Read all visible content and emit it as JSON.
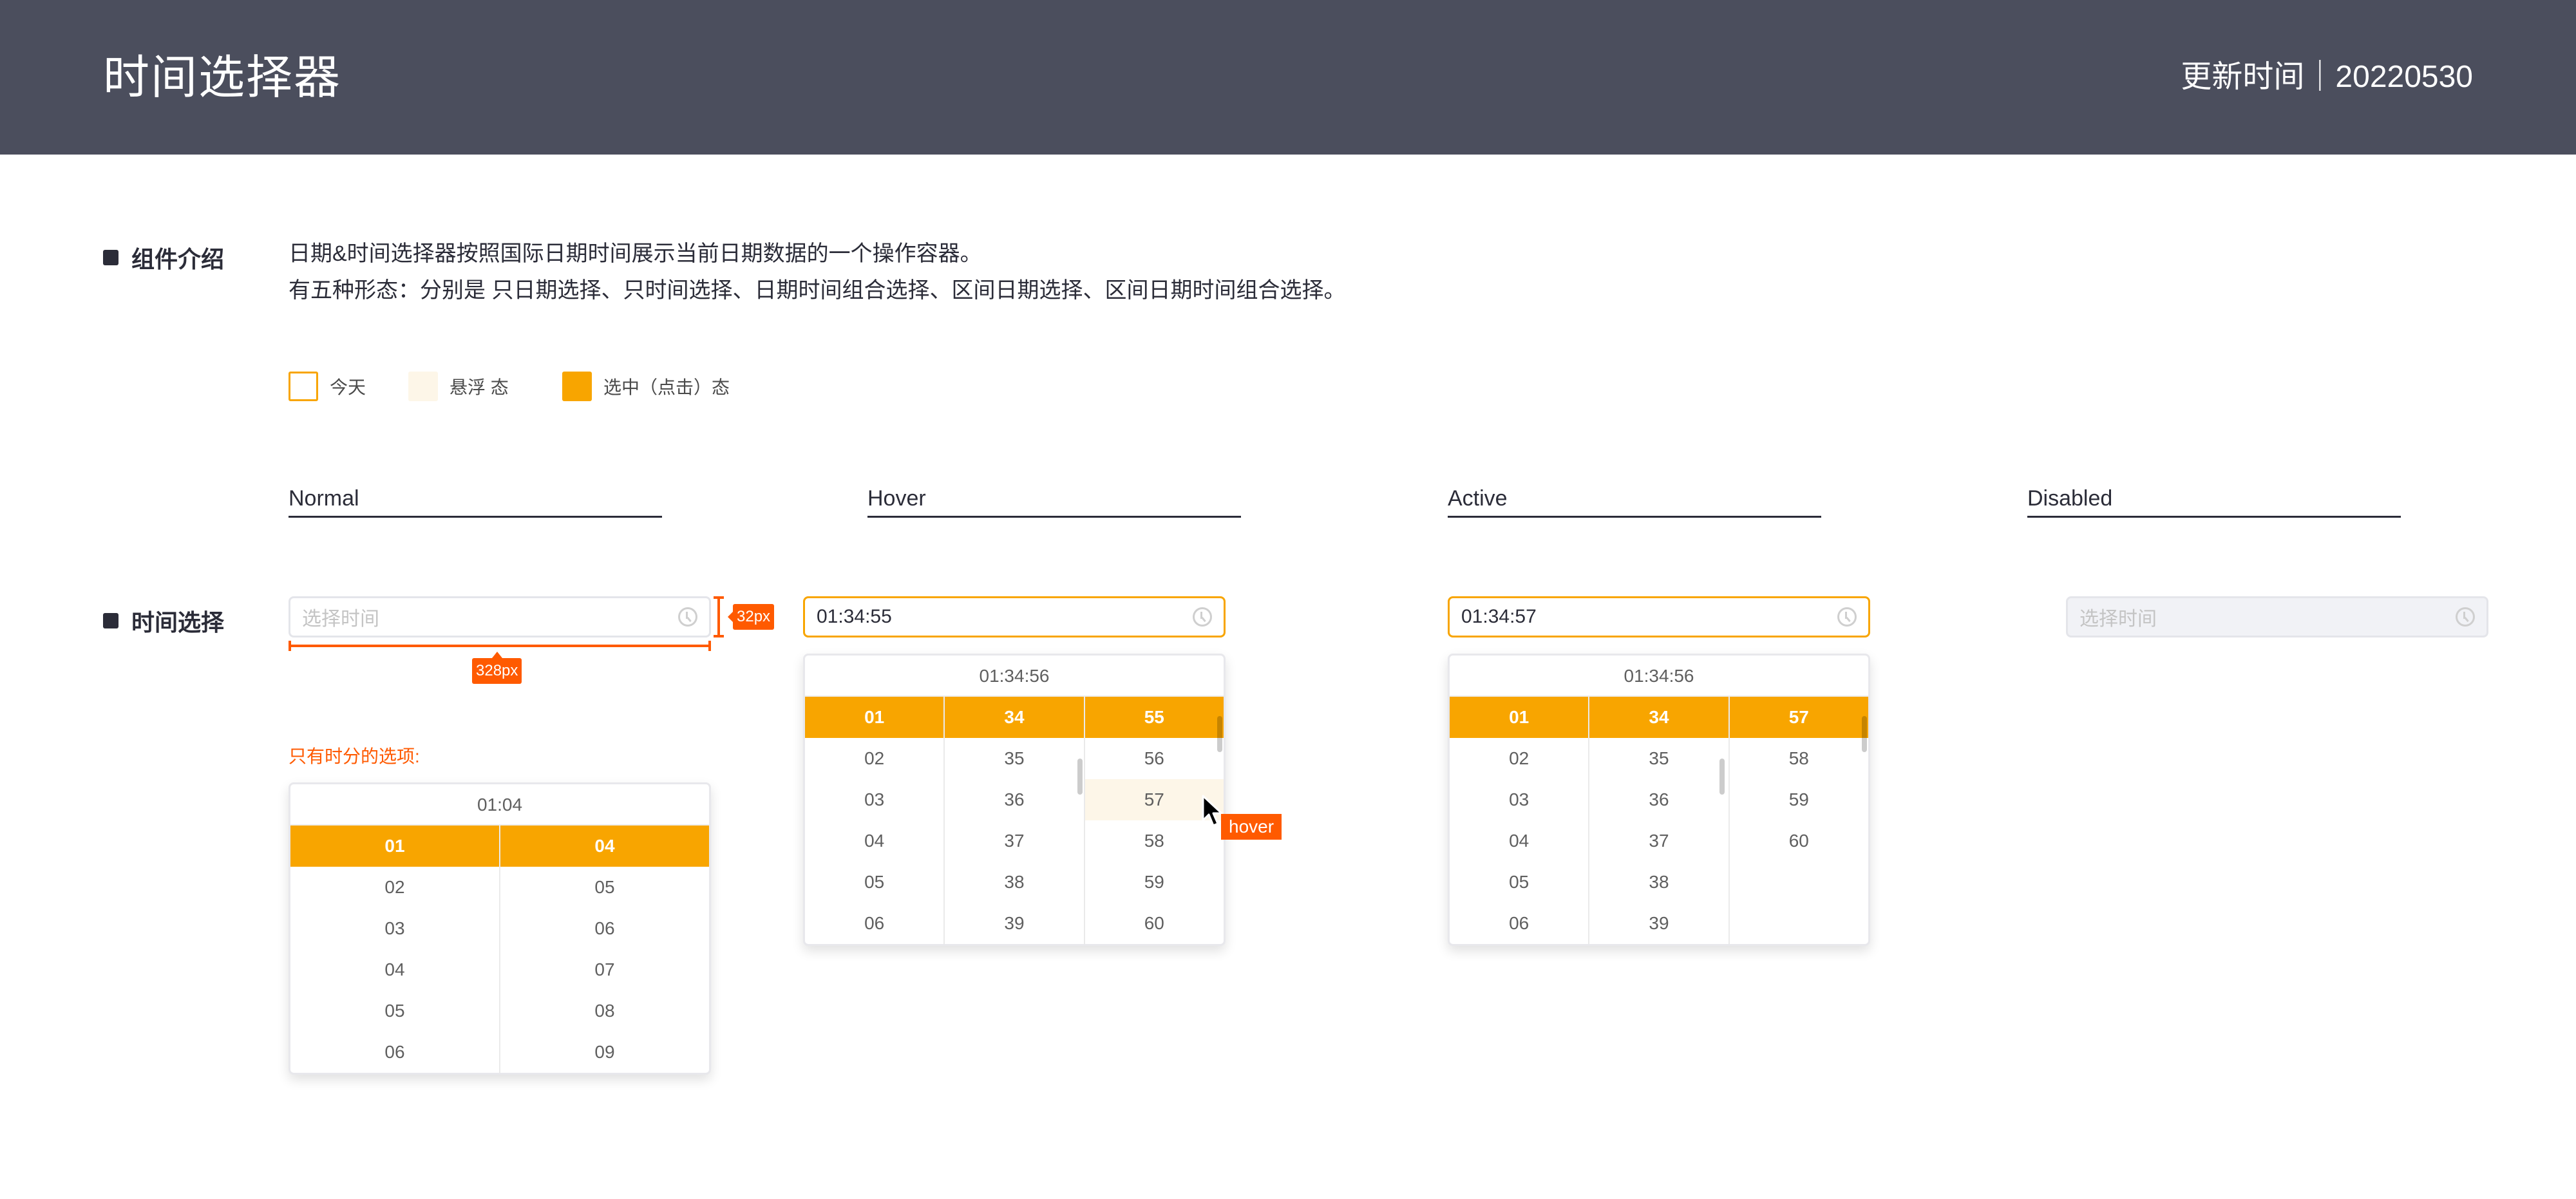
{
  "header": {
    "title": "时间选择器",
    "update_label": "更新时间｜20220530"
  },
  "intro": {
    "section_label": "组件介绍",
    "line1": "日期&时间选择器按照国际日期时间展示当前日期数据的一个操作容器。",
    "line2": "有五种形态：分别是 只日期选择、只时间选择、日期时间组合选择、区间日期选择、区间日期时间组合选择。"
  },
  "legend": [
    {
      "label": "今天",
      "style": "outline",
      "color": "#f8a500"
    },
    {
      "label": "悬浮 态",
      "style": "fill",
      "color": "#fdf6e8"
    },
    {
      "label": "选中（点击）态",
      "style": "fill",
      "color": "#f8a500"
    }
  ],
  "columns": {
    "normal": "Normal",
    "hover": "Hover",
    "active": "Active",
    "disabled": "Disabled"
  },
  "time_section": {
    "section_label": "时间选择",
    "normal": {
      "placeholder": "选择时间",
      "width_label": "328px",
      "height_label": "32px"
    },
    "hour_minute_note": "只有时分的选项:",
    "hour_minute_picker": {
      "header": "01:04",
      "hours": [
        "01",
        "02",
        "03",
        "04",
        "05",
        "06"
      ],
      "minutes": [
        "04",
        "05",
        "06",
        "07",
        "08",
        "09"
      ],
      "selected_hour": "01",
      "selected_minute": "04"
    },
    "hover": {
      "value": "01:34:55",
      "picker_header": "01:34:56",
      "hours": [
        "01",
        "02",
        "03",
        "04",
        "05",
        "06"
      ],
      "minutes": [
        "34",
        "35",
        "36",
        "37",
        "38",
        "39"
      ],
      "seconds": [
        "55",
        "56",
        "57",
        "58",
        "59",
        "60"
      ],
      "selected": [
        "01",
        "34",
        "55"
      ],
      "hovered_second": "57",
      "hover_tag": "hover"
    },
    "active": {
      "value": "01:34:57",
      "picker_header": "01:34:56",
      "hours": [
        "01",
        "02",
        "03",
        "04",
        "05",
        "06"
      ],
      "minutes": [
        "34",
        "35",
        "36",
        "37",
        "38",
        "39"
      ],
      "seconds": [
        "57",
        "58",
        "59",
        "60"
      ],
      "selected": [
        "01",
        "34",
        "57"
      ]
    },
    "disabled": {
      "placeholder": "选择时间"
    }
  },
  "colors": {
    "header_bg": "#4b4e5d",
    "accent": "#f8a500",
    "hover_bg": "#fdf6e8",
    "annotation": "#ff5a00",
    "disabled_bg": "#f1f2f6"
  }
}
